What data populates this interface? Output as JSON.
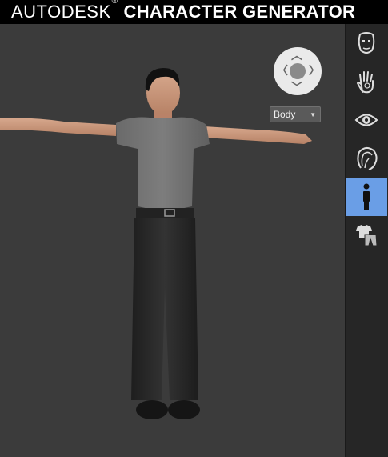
{
  "header": {
    "brand": "AUTODESK",
    "reg_mark": "®",
    "app_title": "CHARACTER GENERATOR"
  },
  "viewport": {
    "view_dropdown": {
      "selected": "Body"
    }
  },
  "sidebar": {
    "items": [
      {
        "name": "face",
        "icon": "face-icon",
        "active": false
      },
      {
        "name": "skin",
        "icon": "skin-hand-icon",
        "active": false
      },
      {
        "name": "eyes",
        "icon": "eye-icon",
        "active": false
      },
      {
        "name": "hair",
        "icon": "hair-icon",
        "active": false
      },
      {
        "name": "body",
        "icon": "body-icon",
        "active": true
      },
      {
        "name": "clothing",
        "icon": "clothing-icon",
        "active": false
      }
    ]
  },
  "colors": {
    "active_tab": "#6a9ee6",
    "header_bg": "#000000",
    "viewport_bg": "#3b3b3b",
    "sidebar_bg": "#262626"
  }
}
